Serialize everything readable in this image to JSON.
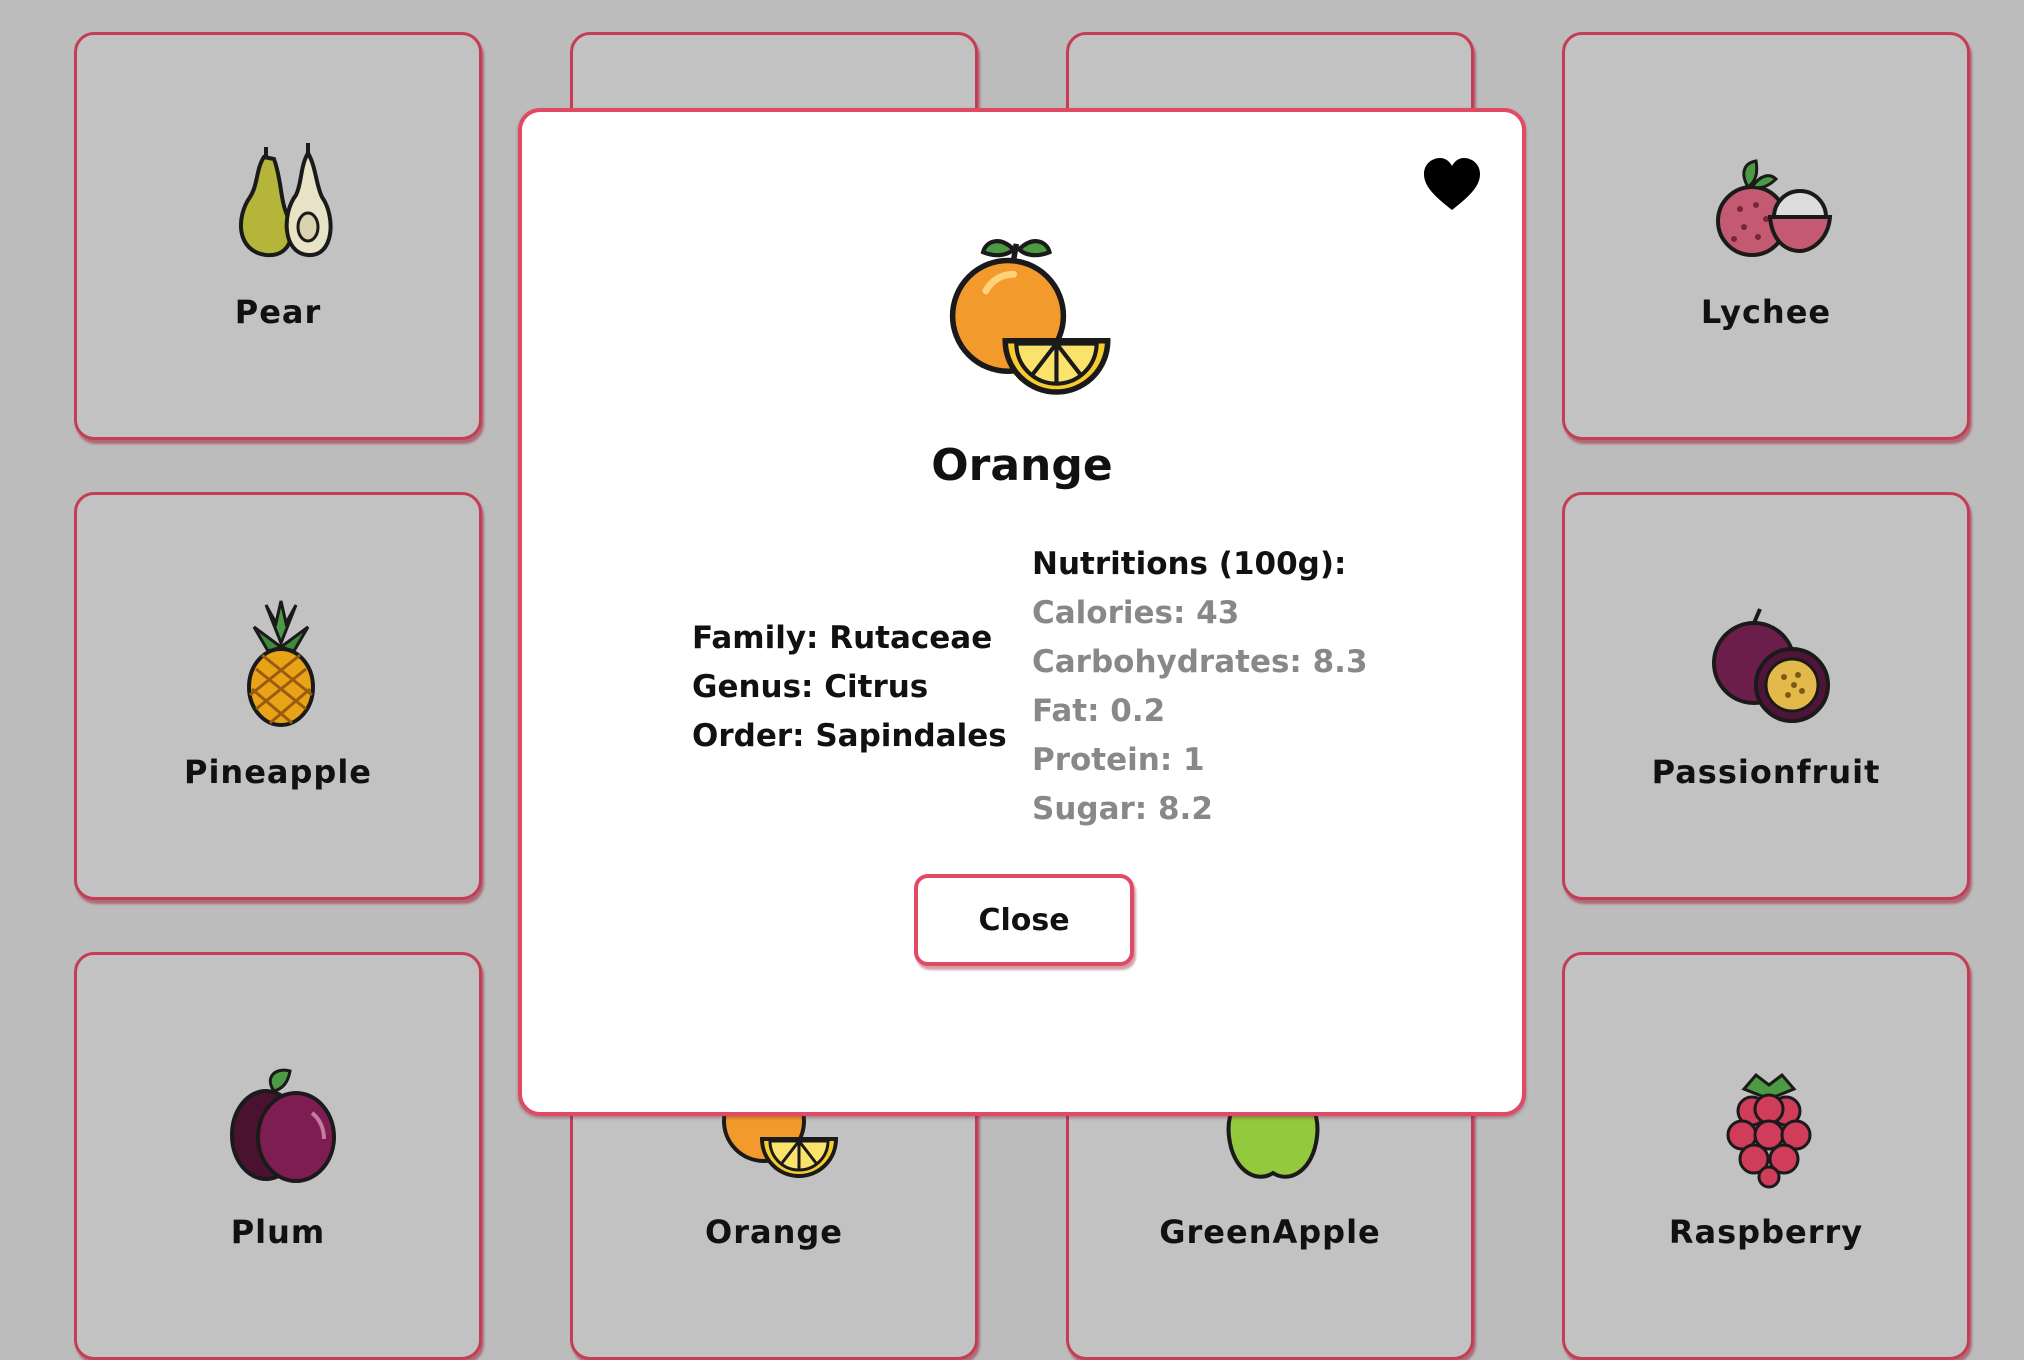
{
  "cards": [
    {
      "name": "Pear",
      "icon": "pear-icon"
    },
    {
      "name": "",
      "icon": ""
    },
    {
      "name": "",
      "icon": ""
    },
    {
      "name": "Lychee",
      "icon": "lychee-icon"
    },
    {
      "name": "Pineapple",
      "icon": "pineapple-icon"
    },
    {
      "name": "Passionfruit",
      "icon": "passionfruit-icon"
    },
    {
      "name": "Plum",
      "icon": "plum-icon"
    },
    {
      "name": "Orange",
      "icon": "orange-icon"
    },
    {
      "name": "GreenApple",
      "icon": "green-apple-icon"
    },
    {
      "name": "Raspberry",
      "icon": "raspberry-icon"
    }
  ],
  "modal": {
    "title": "Orange",
    "icon": "orange-icon",
    "favorite_icon": "heart-icon",
    "family": "Family: Rutaceae",
    "genus": "Genus: Citrus",
    "order": "Order: Sapindales",
    "nutrition_heading": "Nutritions (100g):",
    "calories": "Calories: 43",
    "carbohydrates": "Carbohydrates: 8.3",
    "fat": "Fat: 0.2",
    "protein": "Protein: 1",
    "sugar": "Sugar: 8.2",
    "close_label": "Close"
  },
  "colors": {
    "accent": "#e04a64",
    "card_border": "#c53d55",
    "backdrop": "#bcbcbc",
    "muted_text": "#888888"
  }
}
